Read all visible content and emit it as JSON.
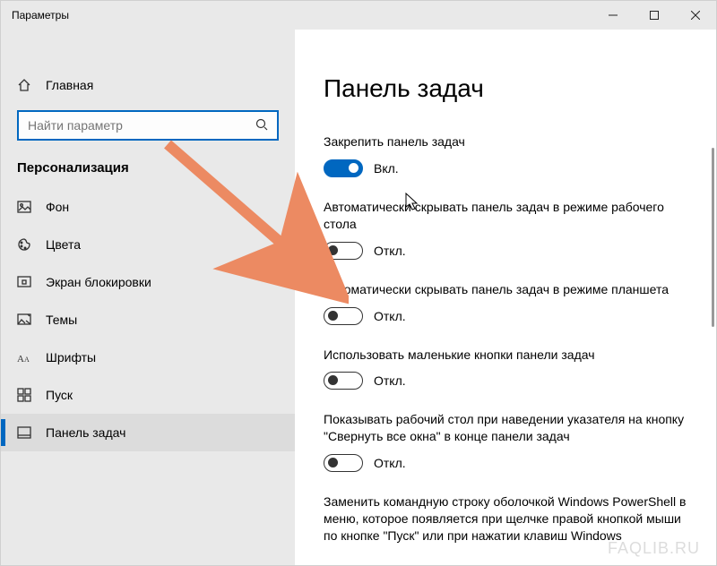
{
  "window": {
    "title": "Параметры"
  },
  "sidebar": {
    "home_label": "Главная",
    "search_placeholder": "Найти параметр",
    "section": "Персонализация",
    "items": [
      {
        "label": "Фон"
      },
      {
        "label": "Цвета"
      },
      {
        "label": "Экран блокировки"
      },
      {
        "label": "Темы"
      },
      {
        "label": "Шрифты"
      },
      {
        "label": "Пуск"
      },
      {
        "label": "Панель задач"
      }
    ]
  },
  "content": {
    "title": "Панель задач",
    "settings": [
      {
        "label": "Закрепить панель задач",
        "on": true,
        "state": "Вкл."
      },
      {
        "label": "Автоматически скрывать панель задач в режиме рабочего стола",
        "on": false,
        "state": "Откл."
      },
      {
        "label": "Автоматически скрывать панель задач в режиме планшета",
        "on": false,
        "state": "Откл."
      },
      {
        "label": "Использовать маленькие кнопки панели задач",
        "on": false,
        "state": "Откл."
      },
      {
        "label": "Показывать рабочий стол при наведении указателя на кнопку \"Свернуть все окна\" в конце панели задач",
        "on": false,
        "state": "Откл."
      }
    ],
    "extra_text": "Заменить командную строку оболочкой Windows PowerShell в меню, которое появляется при щелчке правой кнопкой мыши по кнопке \"Пуск\" или при нажатии клавиш Windows"
  },
  "watermark": "FAQLIB.RU"
}
